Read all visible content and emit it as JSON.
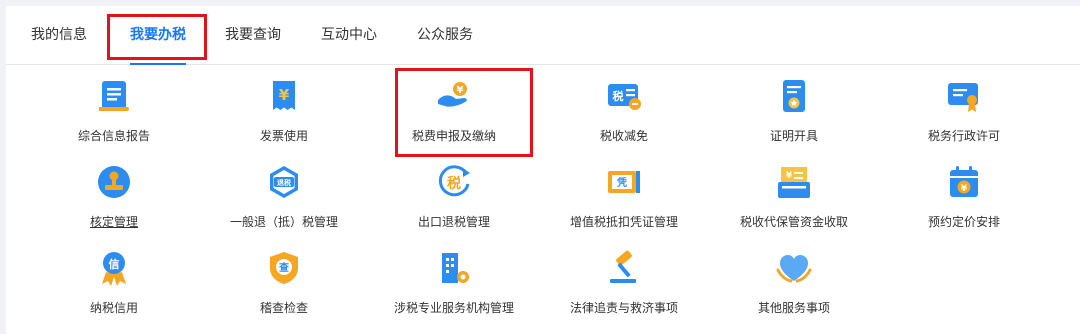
{
  "tabs": [
    {
      "label": "我的信息"
    },
    {
      "label": "我要办税"
    },
    {
      "label": "我要查询"
    },
    {
      "label": "互动中心"
    },
    {
      "label": "公众服务"
    }
  ],
  "active_tab": "我要办税",
  "icon_glyphs": {
    "yuan": "¥",
    "tax": "税",
    "refund": "退税",
    "voucher": "凭",
    "credit": "信",
    "check": "查"
  },
  "services": [
    {
      "label": "综合信息报告",
      "icon": "report-icon"
    },
    {
      "label": "发票使用",
      "icon": "invoice-icon"
    },
    {
      "label": "税费申报及缴纳",
      "icon": "tax-payment-icon"
    },
    {
      "label": "税收减免",
      "icon": "tax-reduction-icon"
    },
    {
      "label": "证明开具",
      "icon": "certificate-icon"
    },
    {
      "label": "税务行政许可",
      "icon": "administrative-license-icon"
    },
    {
      "label": "核定管理",
      "icon": "verification-stamp-icon"
    },
    {
      "label": "一般退（抵）税管理",
      "icon": "tax-refund-icon"
    },
    {
      "label": "出口退税管理",
      "icon": "export-refund-icon"
    },
    {
      "label": "增值税抵扣凭证管理",
      "icon": "vat-voucher-icon"
    },
    {
      "label": "税收代保管资金收取",
      "icon": "custody-fund-icon"
    },
    {
      "label": "预约定价安排",
      "icon": "pricing-calendar-icon"
    },
    {
      "label": "纳税信用",
      "icon": "credit-medal-icon"
    },
    {
      "label": "稽查检查",
      "icon": "inspection-shield-icon"
    },
    {
      "label": "涉税专业服务机构管理",
      "icon": "agency-building-icon"
    },
    {
      "label": "法律追责与救济事项",
      "icon": "legal-gavel-icon"
    },
    {
      "label": "其他服务事项",
      "icon": "other-services-icon"
    }
  ],
  "colors": {
    "accent": "#1677ff",
    "icon_blue": "#2d8cf0",
    "icon_orange": "#f5a623",
    "highlight": "#e0141a"
  }
}
